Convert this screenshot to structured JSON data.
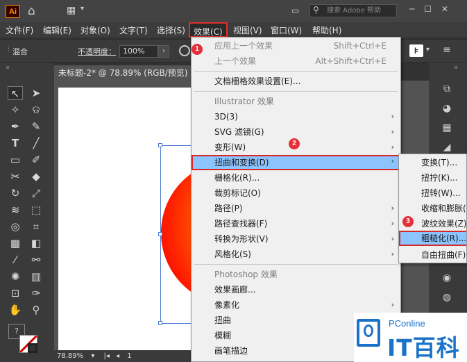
{
  "app": {
    "logo_text": "Ai"
  },
  "titlebar": {
    "search_placeholder": "搜索 Adobe 帮助"
  },
  "menubar": {
    "file": "文件(F)",
    "edit": "编辑(E)",
    "object": "对象(O)",
    "type": "文字(T)",
    "select": "选择(S)",
    "effect": "效果(C)",
    "view": "视图(V)",
    "window": "窗口(W)",
    "help": "帮助(H)"
  },
  "controlbar": {
    "mode_label": "混合",
    "opacity_label": "不透明度：",
    "opacity_value": "100%"
  },
  "document": {
    "tab_title": "未标题-2* @ 78.89% (RGB/预览)"
  },
  "statusbar": {
    "zoom": "78.89%",
    "page": "1"
  },
  "effect_menu": {
    "apply_last": "应用上一个效果",
    "apply_last_shortcut": "Shift+Ctrl+E",
    "last_effect": "上一个效果",
    "last_effect_shortcut": "Alt+Shift+Ctrl+E",
    "raster_settings": "文档栅格效果设置(E)...",
    "illustrator_header": "Illustrator 效果",
    "item_3d": "3D(3)",
    "svg_filters": "SVG 滤镜(G)",
    "warp": "变形(W)",
    "distort_transform": "扭曲和变换(D)",
    "rasterize": "栅格化(R)...",
    "crop_marks": "裁剪标记(O)",
    "path": "路径(P)",
    "pathfinder": "路径查找器(F)",
    "convert_shape": "转换为形状(V)",
    "stylize": "风格化(S)",
    "photoshop_header": "Photoshop 效果",
    "effect_gallery": "效果画廊...",
    "pixelate": "像素化",
    "distort": "扭曲",
    "blur": "模糊",
    "brush_strokes": "画笔描边"
  },
  "distort_submenu": {
    "transform": "变换(T)...",
    "twist": "扭拧(K)...",
    "twirl": "扭转(W)...",
    "pucker_bloat": "收缩和膨胀(P)...",
    "zigzag": "波纹效果(Z)...",
    "roughen": "粗糙化(R)...",
    "free_distort": "自由扭曲(F)..."
  },
  "steps": {
    "one": "1",
    "two": "2",
    "three": "3"
  },
  "watermark": {
    "brand": "PConline",
    "cn": "IT百科"
  },
  "colors": {
    "highlight": "#8cc4ff",
    "callout_red": "#d62828",
    "ui_dark": "#323232"
  },
  "icons": [
    "home-icon",
    "workspace-icon",
    "search-icon",
    "minimize-icon",
    "maximize-icon",
    "close-icon",
    "submenu-arrow-icon"
  ]
}
